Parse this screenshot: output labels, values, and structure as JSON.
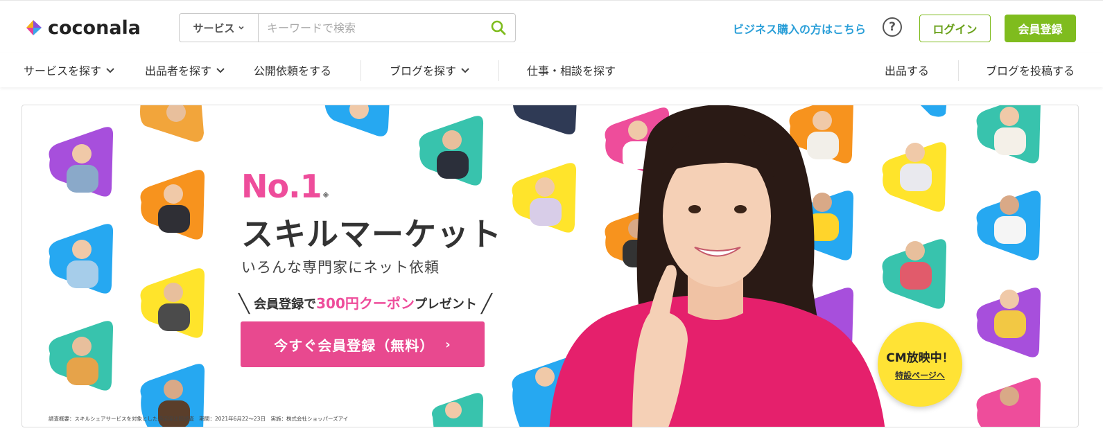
{
  "header": {
    "logo_text": "coconala",
    "search": {
      "category_label": "サービス",
      "placeholder": "キーワードで検索",
      "value": ""
    },
    "business_link": "ビジネス購入の方はこちら",
    "help_label": "?",
    "login_label": "ログイン",
    "register_label": "会員登録"
  },
  "nav": {
    "items": [
      {
        "label": "サービスを探す",
        "dropdown": true
      },
      {
        "label": "出品者を探す",
        "dropdown": true
      },
      {
        "label": "公開依頼をする",
        "dropdown": false
      },
      {
        "label": "ブログを探す",
        "dropdown": true
      },
      {
        "label": "仕事・相談を探す",
        "dropdown": false
      },
      {
        "label": "出品する",
        "dropdown": false
      },
      {
        "label": "ブログを投稿する",
        "dropdown": false
      }
    ]
  },
  "hero": {
    "no1": "No.1",
    "no1_mark": "※",
    "headline": "スキルマーケット",
    "subheadline": "いろんな専門家にネット依頼",
    "coupon": {
      "prefix": "会員登録で",
      "highlight": "300円クーポン",
      "suffix": "プレゼント"
    },
    "cta_label": "今すぐ会員登録（無料）",
    "cm_badge": {
      "title": "CM放映中！",
      "link": "特設ページへ"
    },
    "footnote": "調査概要：スキルシェアサービスを対象とした満足度比較調査　期間：2021年6月22〜23日　実施：株式会社ショッパーズアイ"
  },
  "colors": {
    "brand_green": "#7fbc1e",
    "link_blue": "#2b9fd8",
    "accent_pink": "#ee4d9b",
    "cta_pink": "#e8498f",
    "badge_yellow": "#ffe335"
  },
  "icons": {
    "logo": "coconala-logo-icon",
    "search": "search-icon",
    "chevron": "chevron-down-icon",
    "help": "question-circle-icon"
  }
}
